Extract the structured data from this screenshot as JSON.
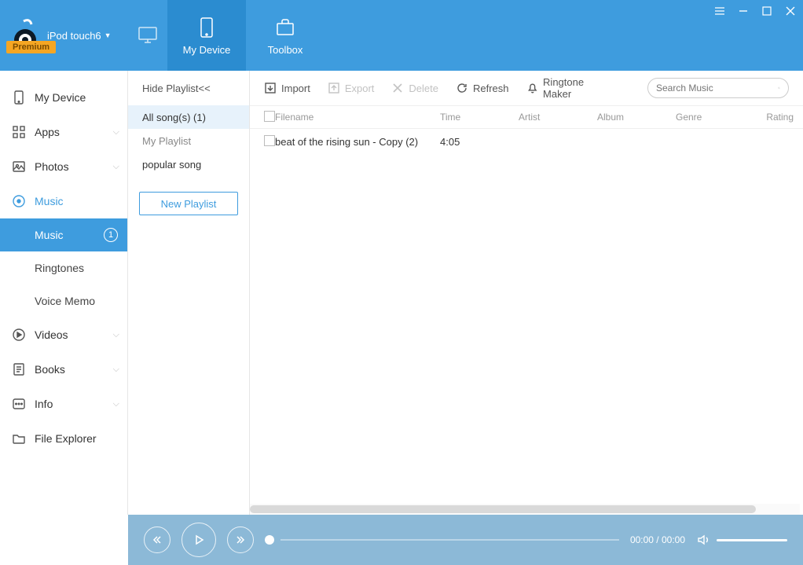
{
  "brand": {
    "device_name": "iPod touch6",
    "premium_label": "Premium"
  },
  "header_tabs": {
    "my_device": "My Device",
    "toolbox": "Toolbox"
  },
  "sidebar": {
    "my_device": "My Device",
    "apps": "Apps",
    "photos": "Photos",
    "music": "Music",
    "videos": "Videos",
    "books": "Books",
    "info": "Info",
    "file_explorer": "File Explorer",
    "music_subs": {
      "music": "Music",
      "music_count": "1",
      "ringtones": "Ringtones",
      "voice_memo": "Voice Memo"
    }
  },
  "playlist": {
    "hide": "Hide Playlist<<",
    "all_songs": "All song(s)  (1)",
    "my_playlist": "My Playlist",
    "popular": "popular song",
    "new_btn": "New Playlist"
  },
  "toolbar": {
    "import": "Import",
    "export": "Export",
    "delete": "Delete",
    "refresh": "Refresh",
    "ringtone_maker": "Ringtone Maker",
    "search_placeholder": "Search Music"
  },
  "columns": {
    "filename": "Filename",
    "time": "Time",
    "artist": "Artist",
    "album": "Album",
    "genre": "Genre",
    "rating": "Rating"
  },
  "rows": [
    {
      "filename": "beat of the rising sun - Copy (2)",
      "time": "4:05"
    }
  ],
  "player": {
    "time_display": "00:00 / 00:00"
  }
}
